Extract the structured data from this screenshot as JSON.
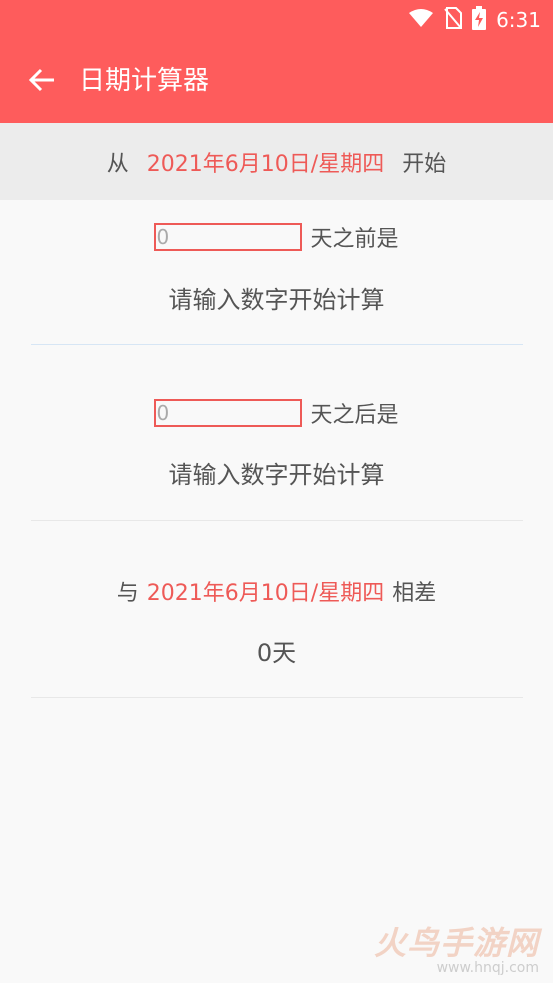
{
  "status_bar": {
    "time": "6:31",
    "icons": [
      "wifi-icon",
      "no-sim-icon",
      "battery-charging-icon"
    ]
  },
  "app_bar": {
    "title": "日期计算器",
    "back_icon": "arrow-left-icon"
  },
  "from_bar": {
    "prefix": "从",
    "date": "2021年6月10日/星期四",
    "suffix": "开始"
  },
  "before_section": {
    "input_value": "",
    "input_placeholder": "0",
    "label": "天之前是",
    "result": "请输入数字开始计算"
  },
  "after_section": {
    "input_value": "",
    "input_placeholder": "0",
    "label": "天之后是",
    "result": "请输入数字开始计算"
  },
  "diff_section": {
    "prefix": "与",
    "date": "2021年6月10日/星期四",
    "suffix": "相差",
    "result": "0天"
  },
  "watermark": {
    "brand": "火鸟手游网",
    "url": "www.hnqj.com"
  },
  "colors": {
    "accent": "#fe5c5c",
    "date_text": "#ee5a57",
    "input_border": "#ee5a57",
    "from_bar_bg": "#ececec",
    "page_bg": "#f9f9f9"
  }
}
